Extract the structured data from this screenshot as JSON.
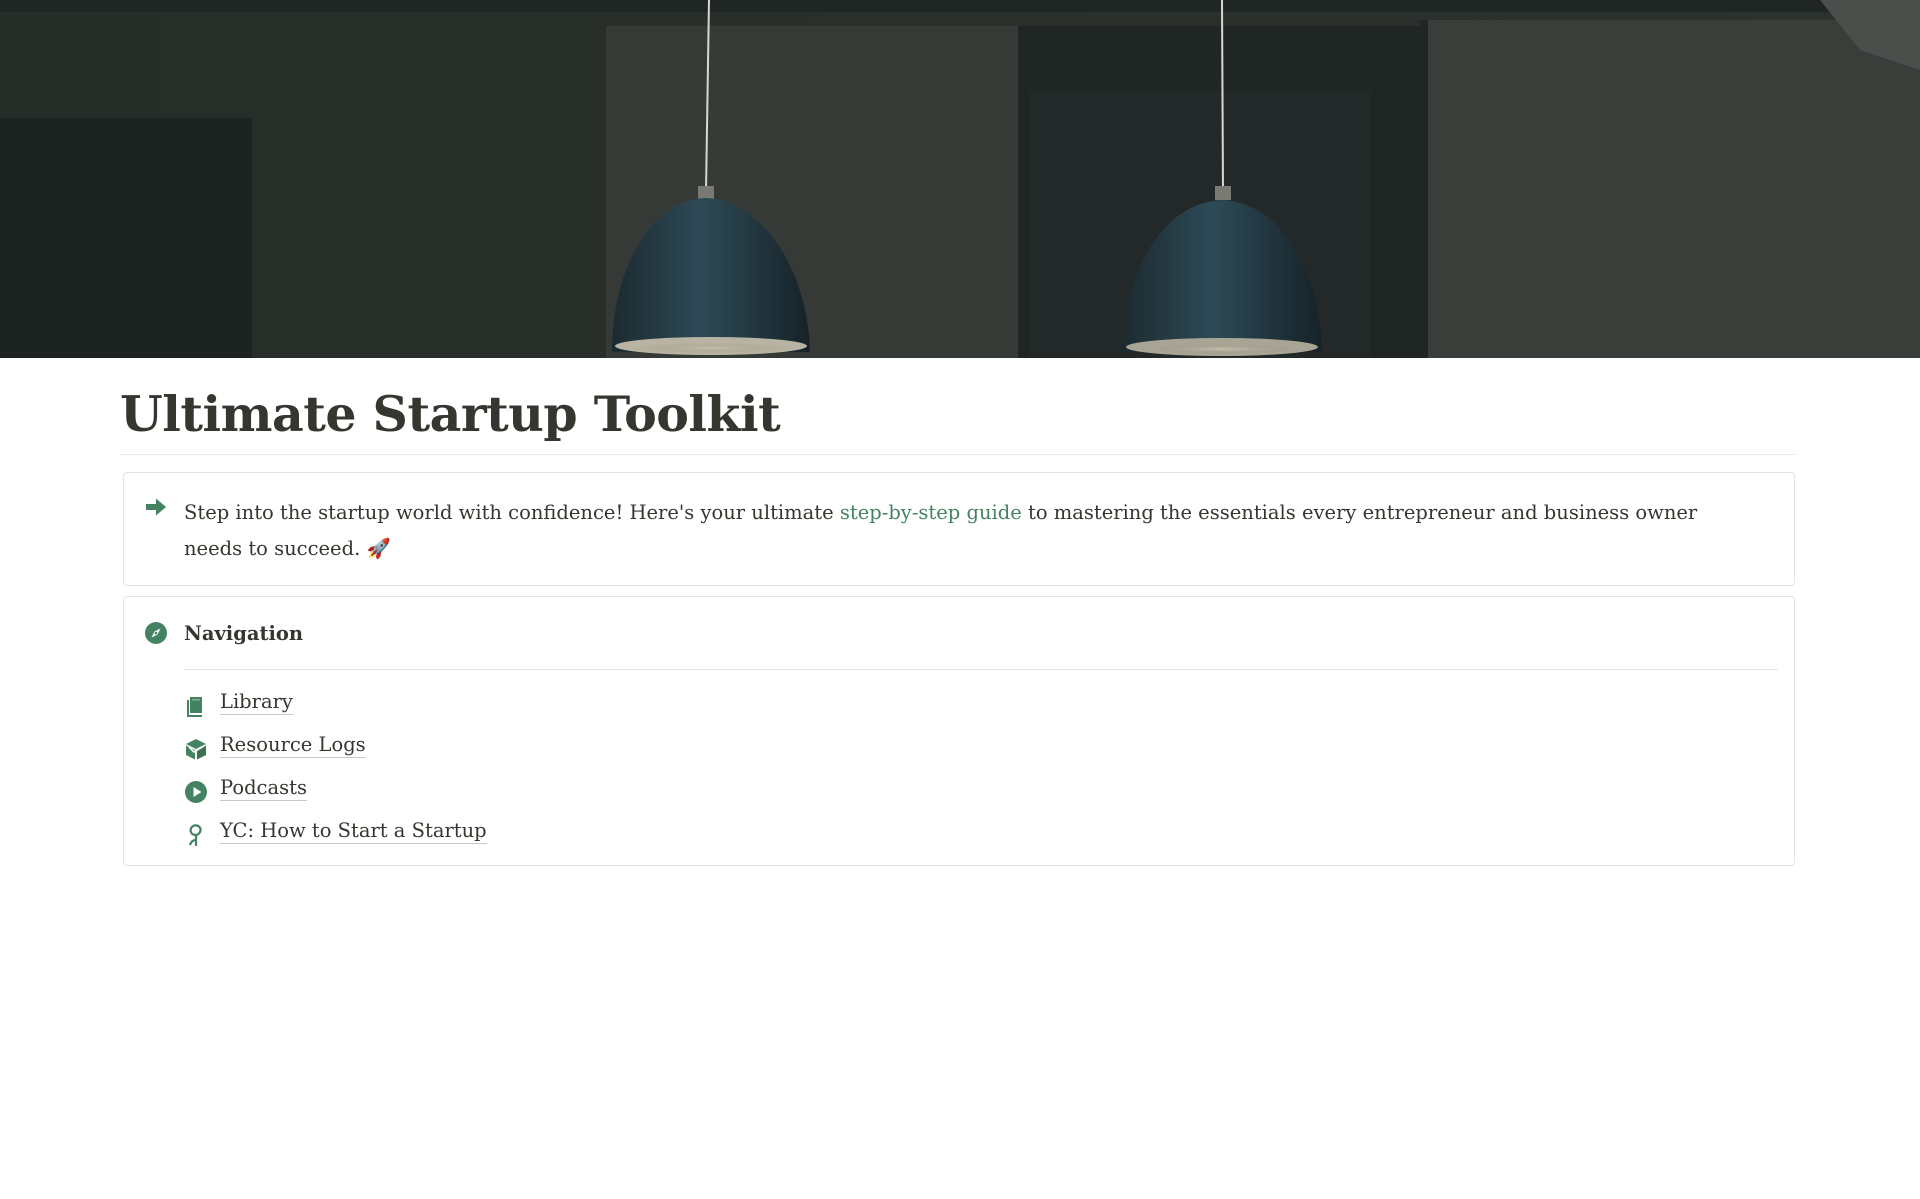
{
  "page": {
    "title": "Ultimate Startup Toolkit",
    "cover": "dark room with two pendant lamps"
  },
  "intro_callout": {
    "icon": "arrow-right-icon",
    "text_before": "Step into the startup world with confidence! Here's your ultimate ",
    "link_text": "step-by-step guide",
    "text_after": " to mastering the essentials every entrepreneur and business owner needs to succeed. ",
    "emoji": "🚀"
  },
  "navigation": {
    "icon": "compass-icon",
    "heading": "Navigation",
    "items": [
      {
        "label": "Library",
        "icon": "book-icon"
      },
      {
        "label": "Resource Logs",
        "icon": "box-icon"
      },
      {
        "label": "Podcasts",
        "icon": "play-circle-icon"
      },
      {
        "label": "YC: How to Start a Startup",
        "icon": "seedling-icon"
      }
    ]
  },
  "colors": {
    "accent": "#448361",
    "text": "#37352f",
    "border": "#e3e3e0"
  }
}
